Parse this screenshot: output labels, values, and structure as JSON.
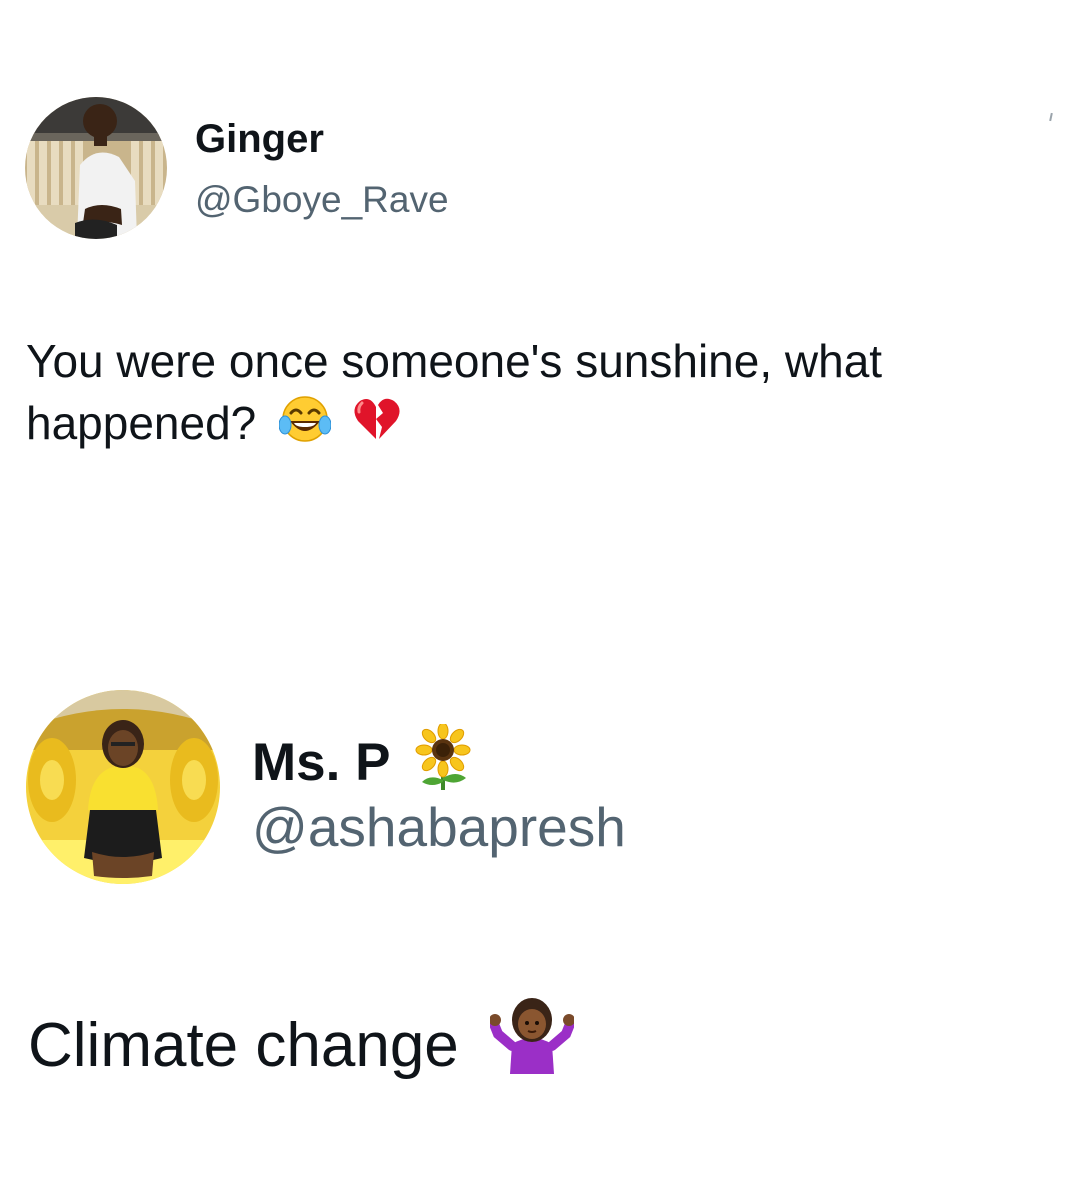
{
  "tweets": [
    {
      "author_name": "Ginger",
      "author_handle": "@Gboye_Rave",
      "text_line1": "You were once someone's sunshine, what",
      "text_line2": "happened?",
      "emojis": [
        "tears-of-joy-emoji",
        "broken-heart-emoji"
      ]
    },
    {
      "author_name": "Ms. P",
      "name_emoji": "sunflower-emoji",
      "author_handle": "@ashabapresh",
      "text": "Climate change",
      "emojis": [
        "woman-shrugging-emoji"
      ]
    }
  ],
  "colors": {
    "text": "#0f1419",
    "handle": "#536471",
    "background": "#ffffff"
  }
}
